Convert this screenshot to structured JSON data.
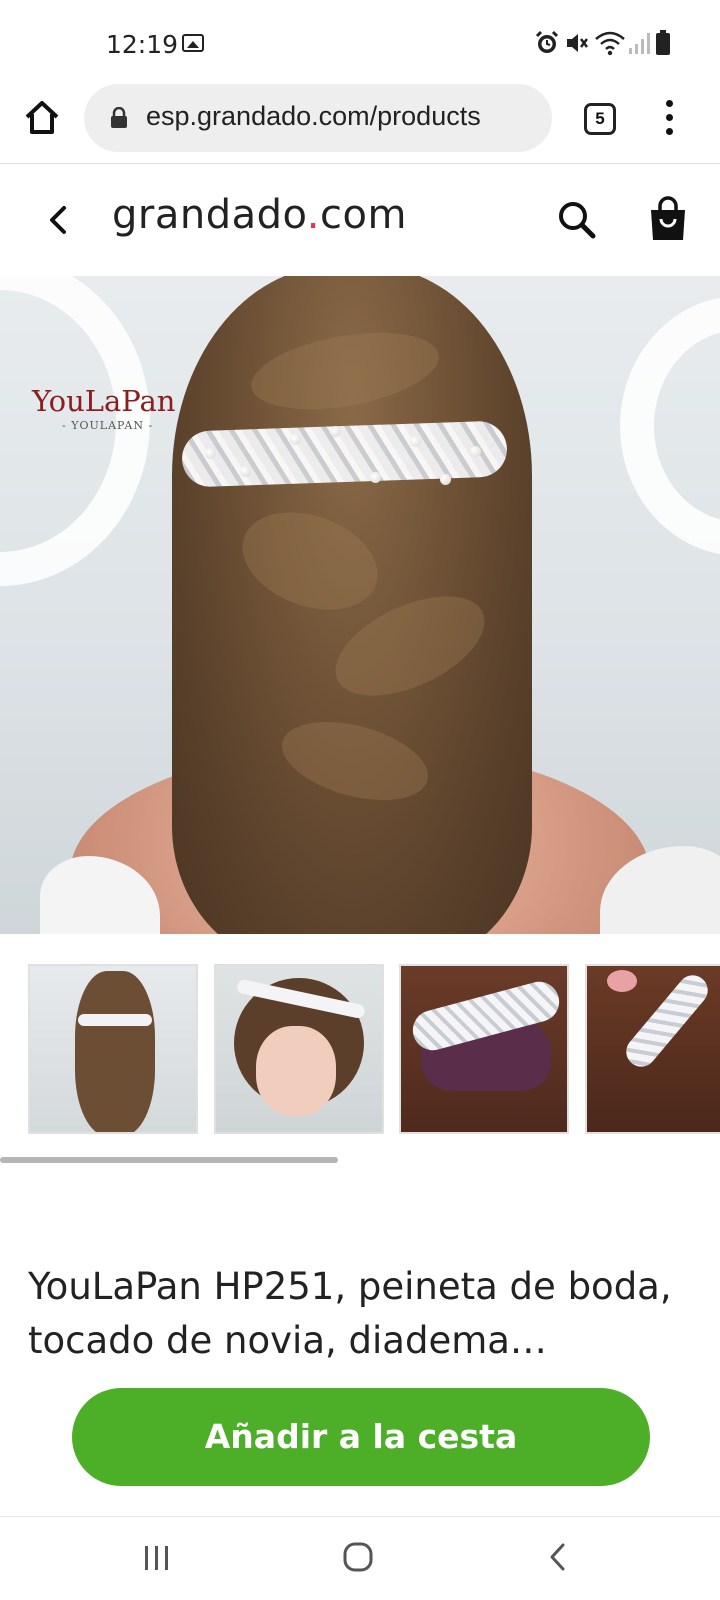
{
  "status_bar": {
    "time": "12:19",
    "icons": [
      "gallery-icon",
      "alarm-icon",
      "mute-icon",
      "wifi-icon",
      "signal-icon",
      "battery-icon"
    ]
  },
  "browser": {
    "url": "esp.grandado.com/products",
    "tab_count": "5",
    "icons": [
      "home-icon",
      "lock-icon",
      "tabs-icon",
      "more-vert-icon"
    ]
  },
  "site_header": {
    "logo_main": "grandado",
    "logo_dot": ".",
    "logo_tld": "com",
    "icons": [
      "chevron-left-icon",
      "search-icon",
      "shopping-bag-icon"
    ],
    "colors": {
      "logo_dot": "#e8334a"
    }
  },
  "product": {
    "hero_watermark": "YouLaPan",
    "hero_watermark_sub": "- YOULAPAN -",
    "thumbnails": [
      {
        "label": "thumbnail-1"
      },
      {
        "label": "thumbnail-2"
      },
      {
        "label": "thumbnail-3"
      },
      {
        "label": "thumbnail-4"
      }
    ],
    "title": "YouLaPan HP251, peineta de boda, tocado de novia, diadema…",
    "add_to_cart": "Añadir a la cesta",
    "colors": {
      "add_to_cart_bg": "#4caf27"
    }
  },
  "nav_bar": {
    "icons": [
      "recent-apps-icon",
      "home-circle-icon",
      "back-icon"
    ]
  }
}
